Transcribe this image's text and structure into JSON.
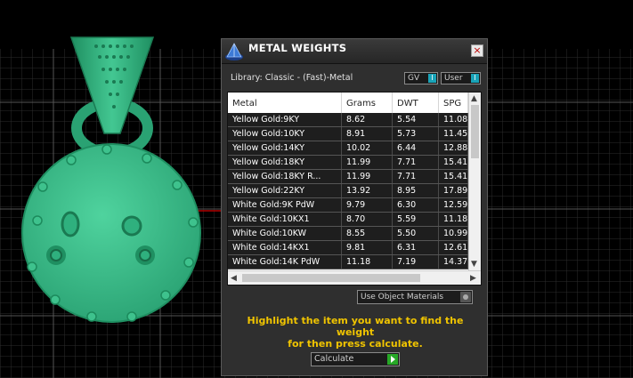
{
  "window": {
    "title": "METAL WEIGHTS",
    "close_label": "×"
  },
  "library": {
    "label": "Library: Classic - (Fast)-Metal"
  },
  "toggles": {
    "gv": "GV",
    "user": "User",
    "knob": "I"
  },
  "table": {
    "columns": [
      "Metal",
      "Grams",
      "DWT",
      "SPG"
    ],
    "rows": [
      [
        "Yellow Gold:9KY",
        "8.62",
        "5.54",
        "11.08"
      ],
      [
        "Yellow Gold:10KY",
        "8.91",
        "5.73",
        "11.45"
      ],
      [
        "Yellow Gold:14KY",
        "10.02",
        "6.44",
        "12.88"
      ],
      [
        "Yellow Gold:18KY",
        "11.99",
        "7.71",
        "15.41"
      ],
      [
        "Yellow Gold:18KY R...",
        "11.99",
        "7.71",
        "15.41"
      ],
      [
        "Yellow Gold:22KY",
        "13.92",
        "8.95",
        "17.89"
      ],
      [
        "White Gold:9K PdW",
        "9.79",
        "6.30",
        "12.59"
      ],
      [
        "White Gold:10KX1",
        "8.70",
        "5.59",
        "11.18"
      ],
      [
        "White Gold:10KW",
        "8.55",
        "5.50",
        "10.99"
      ],
      [
        "White Gold:14KX1",
        "9.81",
        "6.31",
        "12.61"
      ],
      [
        "White Gold:14K PdW",
        "11.18",
        "7.19",
        "14.37"
      ]
    ]
  },
  "materials_dropdown": {
    "label": "Use Object Materials"
  },
  "instruction": {
    "line1": "Highlight the item you want to find the weight",
    "line2": "for then press calculate."
  },
  "calculate_button": {
    "label": "Calculate"
  },
  "colors": {
    "jewel": "#35b884",
    "panel": "#2f2f2f",
    "instruction": "#f0c400",
    "grid": "#3a3a3a"
  }
}
